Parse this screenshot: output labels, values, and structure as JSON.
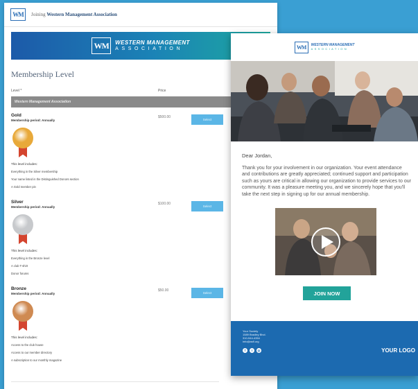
{
  "form": {
    "logo_mark": "WM",
    "joining_prefix": "Joining",
    "org_name": "Western Management Association",
    "banner": {
      "logo_mark": "WM",
      "line1": "WESTERN MANAGEMENT",
      "line2": "ASSOCIATION"
    },
    "title": "Membership Level",
    "columns": {
      "level": "Level *",
      "price": "Price"
    },
    "section_header": "Western Management Association",
    "select_label": "Select",
    "levels": [
      {
        "name": "Gold",
        "period": "Membership period: Annually",
        "price": "$500.00",
        "medal_color": "#e8a93a",
        "ribbon_color": "#d4452f",
        "includes": "This level includes:",
        "items": [
          "Everything in the Silver membership",
          "Your name listed in the Distinguished Donors section",
          "A Gold member pin"
        ]
      },
      {
        "name": "Silver",
        "period": "Membership period: Annually",
        "price": "$100.00",
        "medal_color": "#c7c9cc",
        "ribbon_color": "#d4452f",
        "includes": "This level includes:",
        "items": [
          "Everything in the Bronze level",
          "A club T-shirt",
          "Donor forums"
        ]
      },
      {
        "name": "Bronze",
        "period": "Membership period: Annually",
        "price": "$50.00",
        "medal_color": "#cf8a52",
        "ribbon_color": "#d4452f",
        "includes": "This level includes:",
        "items": [
          "Access to the club house",
          "Access to our member directory",
          "A subscription to our monthly magazine"
        ]
      }
    ]
  },
  "email": {
    "logo_mark": "WM",
    "logo_line1": "WESTERN MANAGEMENT",
    "logo_line2": "ASSOCIATION",
    "greeting": "Dear Jordan,",
    "body": "Thank you for your involvement in our organization. Your event attendance and contributions are greatly appreciated; continued support and participation such as yours are critical in allowing our organization to provide services to our community. It was a pleasure meeting you, and we sincerely hope that you'll take the next step in signing up for our annual membership.",
    "join_label": "JOIN NOW",
    "footer": {
      "org": "Your Society",
      "address": "1589 Bradley Blvd.",
      "phone": "310-544-4354",
      "email": "info@asfl.org",
      "social_icons": [
        "facebook-icon",
        "twitter-icon",
        "instagram-icon"
      ],
      "your_logo": "YOUR LOGO"
    }
  },
  "colors": {
    "background": "#3a9fd3",
    "accent_teal": "#22a39a",
    "footer_blue": "#1c6ab0",
    "select_button": "#5bb6e6"
  }
}
